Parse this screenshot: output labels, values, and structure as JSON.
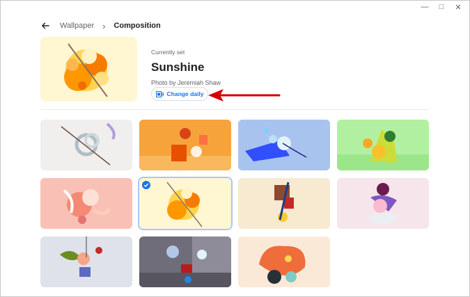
{
  "window": {
    "controls": [
      "minimize",
      "maximize",
      "close"
    ]
  },
  "breadcrumb": {
    "back_icon": "arrow-left-icon",
    "parent": "Wallpaper",
    "current": "Composition"
  },
  "current_wallpaper": {
    "label": "Currently set",
    "title": "Sunshine",
    "credit": "Photo by Jeremiah Shaw",
    "change_daily_label": "Change daily",
    "change_daily_icon": "shuffle-gallery-icon"
  },
  "accent_color": "#1a73e8",
  "annotation": {
    "arrow_color": "#d50000"
  },
  "wallpapers": [
    {
      "id": "w1",
      "selected": false
    },
    {
      "id": "w2",
      "selected": false
    },
    {
      "id": "w3",
      "selected": false
    },
    {
      "id": "w4",
      "selected": false
    },
    {
      "id": "w5",
      "selected": false
    },
    {
      "id": "w6",
      "selected": true
    },
    {
      "id": "w7",
      "selected": false
    },
    {
      "id": "w8",
      "selected": false
    },
    {
      "id": "w9",
      "selected": false
    },
    {
      "id": "w10",
      "selected": false
    },
    {
      "id": "w11",
      "selected": false
    }
  ]
}
